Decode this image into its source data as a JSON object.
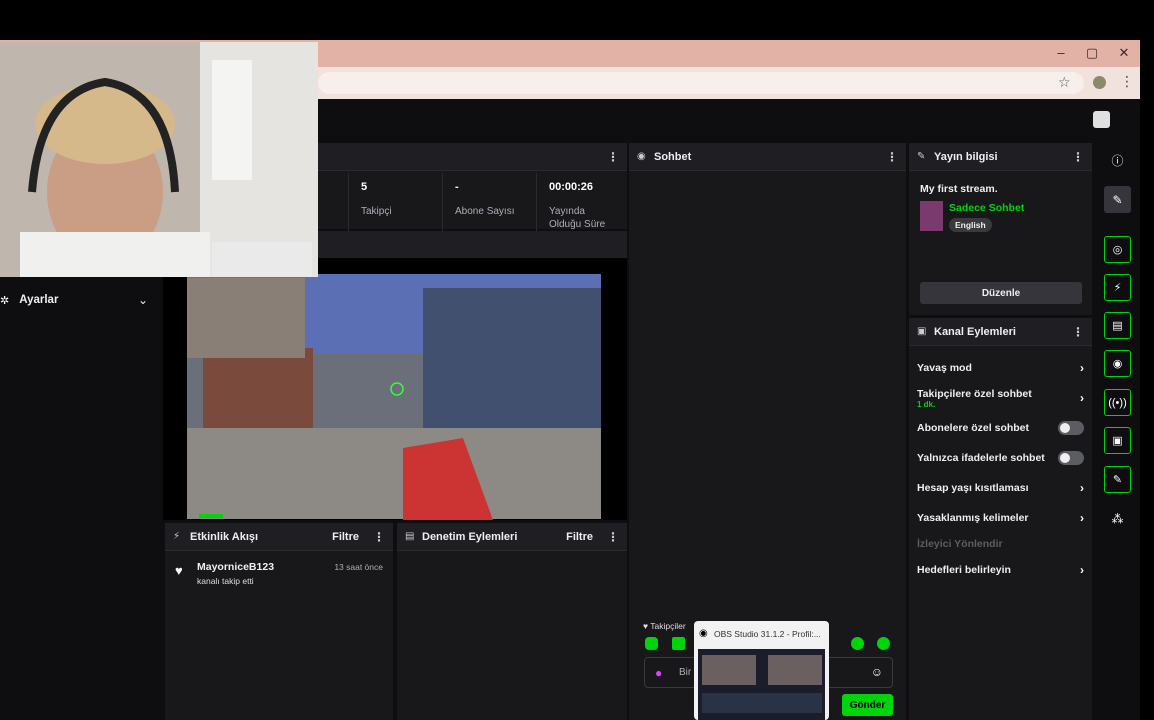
{
  "stats": [
    {
      "value": "5",
      "label": "Takipçi"
    },
    {
      "value": "-",
      "label": "Abone Sayısı"
    },
    {
      "value": "00:00:26",
      "label": "Yayında Olduğu Süre"
    }
  ],
  "settings": {
    "label": "Ayarlar"
  },
  "chat": {
    "title": "Sohbet",
    "followers_label": "Takipçiler",
    "input_placeholder": "Bir",
    "send_label": "Gönder"
  },
  "stream_info": {
    "title": "Yayın bilgisi",
    "stream_title": "My first stream.",
    "category": "Sadece Sohbet",
    "language": "English",
    "edit_label": "Düzenle"
  },
  "channel_actions": {
    "title": "Kanal Eylemleri",
    "items": [
      {
        "label": "Yavaş mod",
        "control": "chevron"
      },
      {
        "label": "Takipçilere özel sohbet",
        "sub": "1 dk.",
        "control": "chevron"
      },
      {
        "label": "Abonelere özel sohbet",
        "control": "toggle"
      },
      {
        "label": "Yalnızca ifadelerle sohbet",
        "control": "toggle"
      },
      {
        "label": "Hesap yaşı kısıtlaması",
        "control": "chevron"
      },
      {
        "label": "Yasaklanmış kelimeler",
        "control": "chevron"
      },
      {
        "label": "İzleyici Yönlendir",
        "control": "none",
        "disabled": true
      },
      {
        "label": "Hedefleri belirleyin",
        "control": "chevron"
      }
    ]
  },
  "activity_feed": {
    "title": "Etkinlik Akışı",
    "filter_label": "Filtre",
    "events": [
      {
        "user": "MayorniceB123",
        "time": "13 saat önce",
        "action": "kanalı takip etti"
      }
    ]
  },
  "moderation": {
    "title": "Denetim Eylemleri",
    "filter_label": "Filtre"
  },
  "taskbar_preview": {
    "title": "OBS Studio 31.1.2 - Profil:..."
  },
  "colors": {
    "accent": "#00d40b",
    "panel": "#18181b",
    "background": "#0e0e10",
    "chrome": "#e2b2a6"
  }
}
